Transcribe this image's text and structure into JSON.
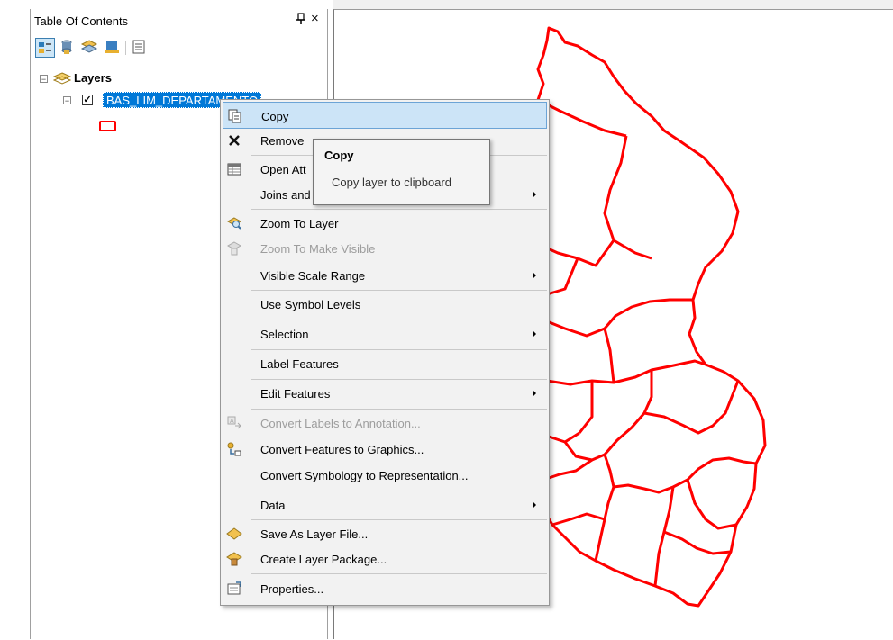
{
  "toc": {
    "title": "Table Of Contents",
    "pin_glyph": "⨁",
    "close_glyph": "×",
    "toolbar": [
      "list-by-drawing-order-icon",
      "list-by-source-icon",
      "list-by-visibility-icon",
      "list-by-selection-icon",
      "options-icon"
    ],
    "tree": {
      "root_label": "Layers",
      "root_expander": "−",
      "layer_label": "BAS_LIM_DEPARTAMENTO",
      "layer_expander": "−",
      "layer_checked": "✓",
      "symbol_color": "#ff0000"
    }
  },
  "context_menu": {
    "items": [
      {
        "label": "Copy",
        "icon": "copy-icon",
        "selected": true,
        "submenu": false
      },
      {
        "label": "Remove",
        "icon": "remove-icon",
        "selected": false,
        "submenu": false
      },
      {
        "label": "Open Att",
        "icon": "attribute-table-icon",
        "selected": false,
        "submenu": false
      },
      {
        "label": "Joins and",
        "icon": "",
        "selected": false,
        "submenu": true
      },
      {
        "label": "Zoom To Layer",
        "icon": "zoom-to-layer-icon",
        "selected": false,
        "submenu": false
      },
      {
        "label": "Zoom To Make Visible",
        "icon": "zoom-to-visible-icon",
        "disabled": true,
        "submenu": false
      },
      {
        "label": "Visible Scale Range",
        "icon": "",
        "submenu": true
      },
      {
        "label": "Use Symbol Levels",
        "icon": "",
        "submenu": false
      },
      {
        "label": "Selection",
        "icon": "",
        "submenu": true
      },
      {
        "label": "Label Features",
        "icon": "",
        "submenu": false
      },
      {
        "label": "Edit Features",
        "icon": "",
        "submenu": true
      },
      {
        "label": "Convert Labels to Annotation...",
        "icon": "convert-labels-icon",
        "disabled": true,
        "submenu": false
      },
      {
        "label": "Convert Features to Graphics...",
        "icon": "convert-features-icon",
        "submenu": false
      },
      {
        "label": "Convert Symbology to Representation...",
        "icon": "",
        "submenu": false
      },
      {
        "label": "Data",
        "icon": "",
        "submenu": true
      },
      {
        "label": "Save As Layer File...",
        "icon": "save-layer-file-icon",
        "submenu": false
      },
      {
        "label": "Create Layer Package...",
        "icon": "layer-package-icon",
        "submenu": false
      },
      {
        "label": "Properties...",
        "icon": "properties-icon",
        "submenu": false
      }
    ]
  },
  "tooltip": {
    "title": "Copy",
    "description": "Copy layer to clipboard"
  },
  "map": {
    "boundary_color": "#ff0000",
    "background": "#ffffff"
  }
}
